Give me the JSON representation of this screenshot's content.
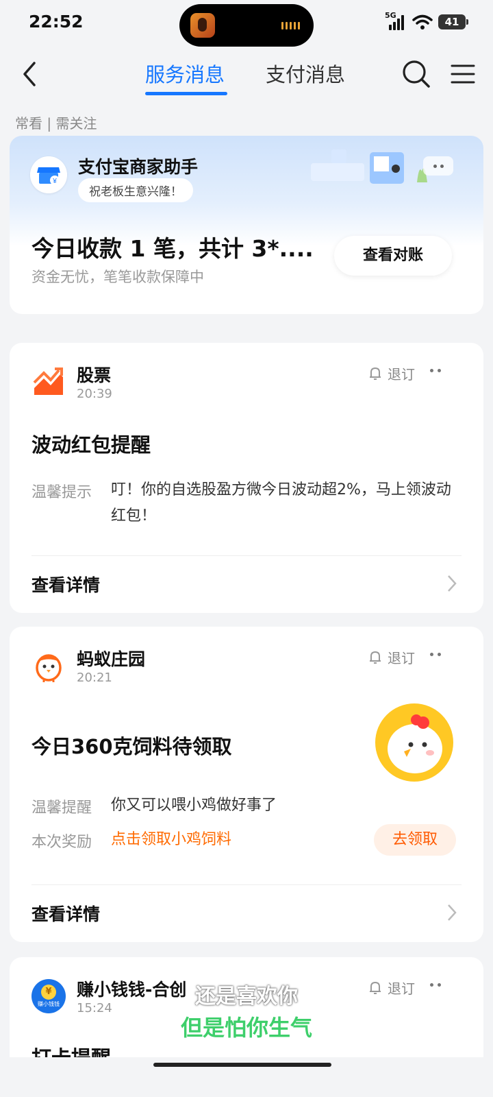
{
  "status_bar": {
    "time": "22:52",
    "network": "5G",
    "battery": "41"
  },
  "nav": {
    "tabs": [
      "服务消息",
      "支付消息"
    ],
    "active_tab": "服务消息"
  },
  "filter": "常看 | 需关注",
  "merchant_card": {
    "title": "支付宝商家助手",
    "greeting": "祝老板生意兴隆！",
    "headline": "今日收款 1 笔，共计 3*....",
    "subtext": "资金无忧，笔笔收款保障中",
    "button": "查看对账"
  },
  "messages": [
    {
      "name": "股票",
      "time": "20:39",
      "unsubscribe": "退订",
      "headline": "波动红包提醒",
      "rows": [
        {
          "label": "温馨提示",
          "value": "叮！你的自选股盈方微今日波动超2%，马上领波动红包！"
        }
      ],
      "detail": "查看详情"
    },
    {
      "name": "蚂蚁庄园",
      "time": "20:21",
      "unsubscribe": "退订",
      "headline": "今日360克饲料待领取",
      "rows": [
        {
          "label": "温馨提醒",
          "value": "你又可以喂小鸡做好事了"
        },
        {
          "label": "本次奖励",
          "value": "点击领取小鸡饲料"
        }
      ],
      "action": "去领取",
      "detail": "查看详情"
    },
    {
      "name": "赚小钱钱-合创",
      "time": "15:24",
      "unsubscribe": "退订",
      "headline": "打卡提醒",
      "icon_text": "赚小钱钱"
    }
  ],
  "subtitles": [
    "还是喜欢你",
    "但是怕你生气"
  ],
  "colors": {
    "accent": "#1677ff",
    "orange": "#ff6a00",
    "subtitle_green": "#3ecf6b"
  }
}
